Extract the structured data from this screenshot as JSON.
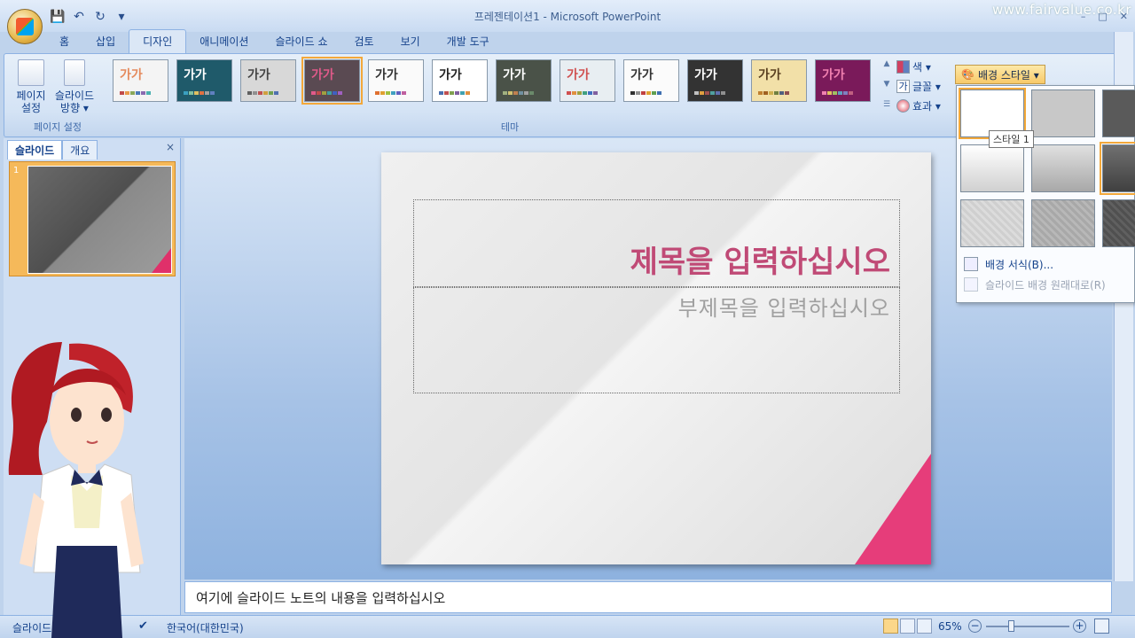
{
  "window": {
    "title": "프레젠테이션1 - Microsoft PowerPoint",
    "watermark": "www.fairvalue.co.kr",
    "controls": [
      "–",
      "□",
      "✕"
    ]
  },
  "quick_access": {
    "icons": [
      "save-icon",
      "undo-icon",
      "redo-icon",
      "customize-icon"
    ]
  },
  "tabs": [
    "홈",
    "삽입",
    "디자인",
    "애니메이션",
    "슬라이드 쇼",
    "검토",
    "보기",
    "개발 도구"
  ],
  "active_tab": "디자인",
  "help_label": "?",
  "ribbon": {
    "page_setup_group": {
      "label": "페이지 설정",
      "page_setup_btn": "페이지\n설정",
      "orientation_btn": "슬라이드\n방향 ▾"
    },
    "theme_group": {
      "label": "테마",
      "themes": [
        {
          "text": "가가",
          "bg": "#f4f4f4",
          "fg": "#e58a5c",
          "bars": [
            "#c04a4a",
            "#e89a4a",
            "#8aa85a",
            "#4a7ab8",
            "#8a6ab0",
            "#4ab0b0"
          ]
        },
        {
          "text": "가가",
          "bg": "#1f5a6a",
          "fg": "#ffffff",
          "bars": [
            "#3aa0c0",
            "#80c0a0",
            "#e0c060",
            "#e07040",
            "#a0a0a0",
            "#6080c0"
          ]
        },
        {
          "text": "가가",
          "bg": "#d8d8d8",
          "fg": "#444444",
          "bars": [
            "#606060",
            "#909090",
            "#c05050",
            "#d0a040",
            "#70a050",
            "#5070b0"
          ]
        },
        {
          "text": "가가",
          "bg": "#5a4a52",
          "fg": "#e05a8a",
          "bars": [
            "#e05a8a",
            "#c04a4a",
            "#a0a040",
            "#40a0a0",
            "#4060c0",
            "#a060c0"
          ]
        },
        {
          "text": "가가",
          "bg": "#fafafa",
          "fg": "#333333",
          "bars": [
            "#e07030",
            "#e0a030",
            "#a0c040",
            "#40a0c0",
            "#6060c0",
            "#c060a0"
          ]
        },
        {
          "text": "가가",
          "bg": "#ffffff",
          "fg": "#222222",
          "bars": [
            "#4a70b0",
            "#c05050",
            "#80a050",
            "#8060a0",
            "#40a0b0",
            "#e09040"
          ]
        },
        {
          "text": "가가",
          "bg": "#4a5248",
          "fg": "#ffffff",
          "bars": [
            "#a0b080",
            "#d0c070",
            "#c08050",
            "#7090a0",
            "#a0a0a0",
            "#6a8a6a"
          ]
        },
        {
          "text": "가가",
          "bg": "#e8eef2",
          "fg": "#d05050",
          "bars": [
            "#d05050",
            "#e09040",
            "#a0a040",
            "#40a080",
            "#4070c0",
            "#8060a0"
          ]
        },
        {
          "text": "가가",
          "bg": "#fbfbfb",
          "fg": "#333333",
          "bars": [
            "#303030",
            "#909090",
            "#c04040",
            "#e0a030",
            "#60a050",
            "#4070b0"
          ]
        },
        {
          "text": "가가",
          "bg": "#333333",
          "fg": "#ffffff",
          "bars": [
            "#c0c0c0",
            "#e0a040",
            "#a05050",
            "#50a0a0",
            "#6070b0",
            "#909090"
          ]
        },
        {
          "text": "가가",
          "bg": "#f2e0a8",
          "fg": "#5a4020",
          "bars": [
            "#c08030",
            "#a06020",
            "#d0b050",
            "#708040",
            "#506080",
            "#905050"
          ]
        },
        {
          "text": "가가",
          "bg": "#7a1a5a",
          "fg": "#f080b0",
          "bars": [
            "#f080b0",
            "#e0c060",
            "#a0c060",
            "#60a0c0",
            "#8080c0",
            "#c06080"
          ]
        }
      ],
      "selected_index": 3
    },
    "theme_options": {
      "colors": "색 ▾",
      "fonts": "글꼴 ▾",
      "effects": "효과 ▾"
    },
    "bg_styles_btn": "배경 스타일 ▾"
  },
  "slides_pane": {
    "tab_slides": "슬라이드",
    "tab_outline": "개요",
    "close": "×",
    "slide_number": "1"
  },
  "slide": {
    "title": "제목을 입력하십시오",
    "subtitle": "부제목을 입력하십시오",
    "accent_color": "#e63d7a"
  },
  "notes": {
    "text": "여기에 슬라이드 노트의 내용을 입력하십시오"
  },
  "status": {
    "slide_info": "슬라이드",
    "language": "한국어(대한민국)",
    "zoom": "65%",
    "zoom_level_percent": 65
  },
  "bg_dropdown": {
    "options": [
      {
        "bg": "#ffffff"
      },
      {
        "bg": "#c8c8c8"
      },
      {
        "bg": "#5a5a5a"
      },
      {
        "bg": "linear-gradient(#ffffff,#d0d0d0)"
      },
      {
        "bg": "linear-gradient(#e0e0e0,#a8a8a8)"
      },
      {
        "bg": "linear-gradient(#707070,#404040)"
      },
      {
        "bg": "repeating-linear-gradient(45deg,#cfcfcf 0 3px,#dcdcdc 3px 6px)"
      },
      {
        "bg": "repeating-linear-gradient(45deg,#a8a8a8 0 3px,#b8b8b8 3px 6px)"
      },
      {
        "bg": "repeating-linear-gradient(45deg,#505050 0 3px,#606060 3px 6px)"
      }
    ],
    "tooltip": "스타일 1",
    "format_bg": "배경 서식(B)...",
    "reset_bg": "슬라이드 배경 원래대로(R)"
  }
}
